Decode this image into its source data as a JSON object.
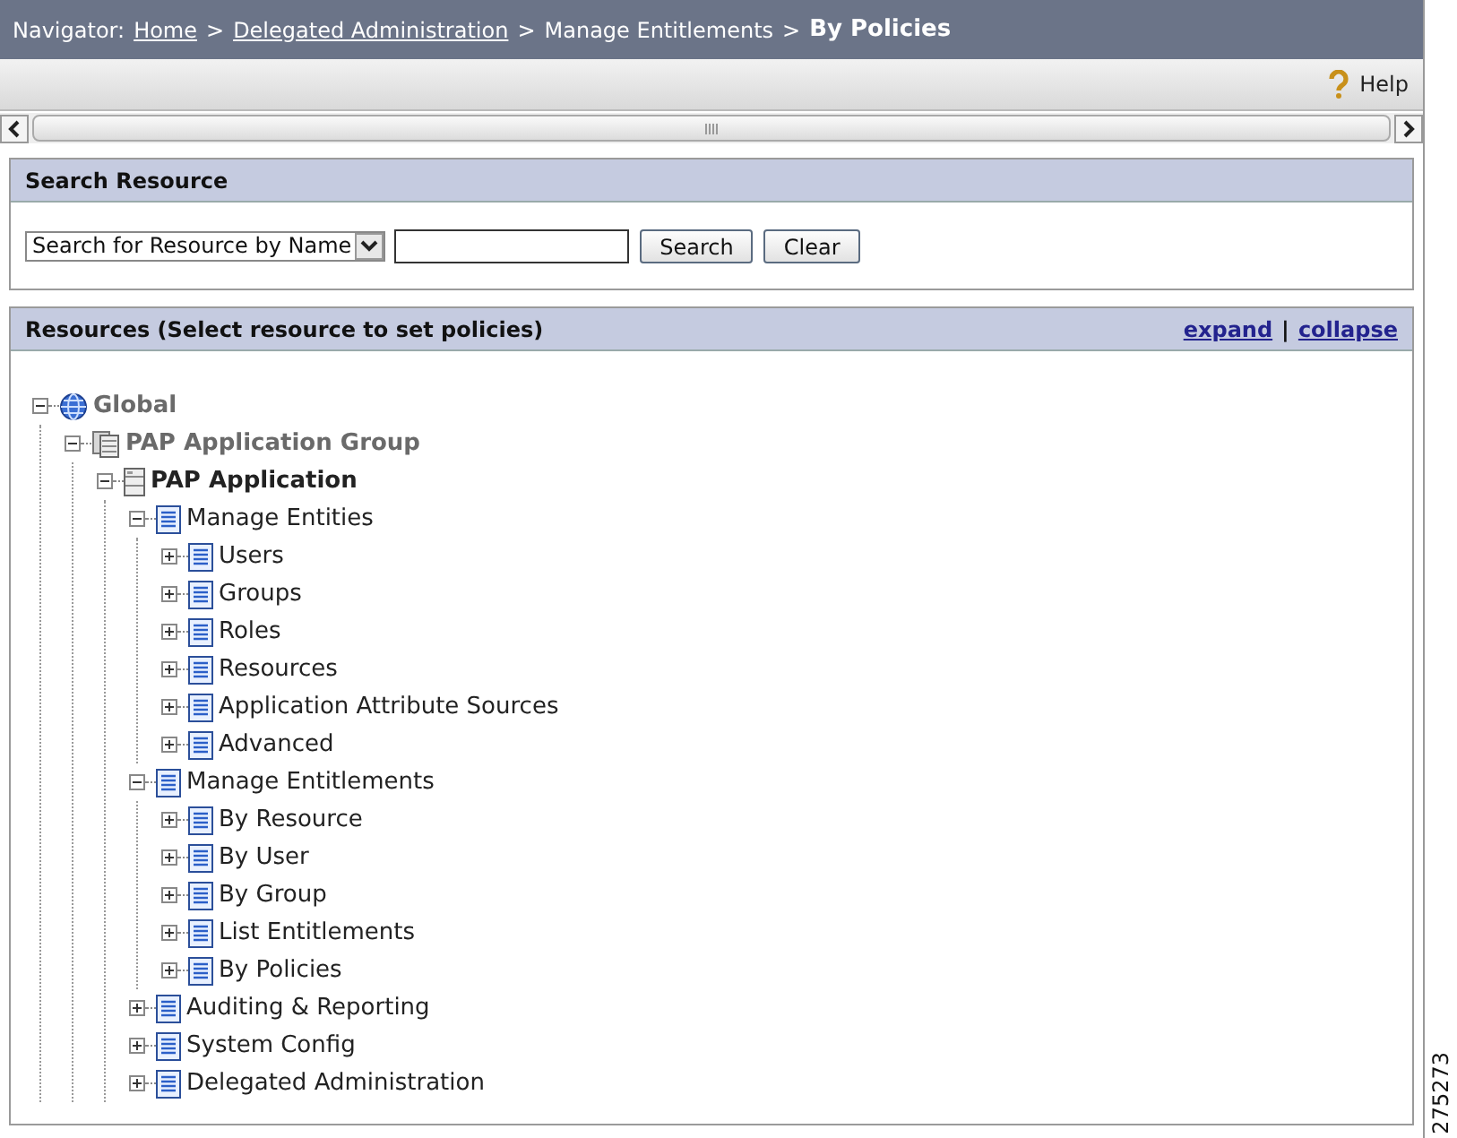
{
  "navigator": {
    "label": "Navigator:",
    "crumbs": [
      {
        "text": "Home",
        "kind": "link"
      },
      {
        "text": "Delegated Administration",
        "kind": "link"
      },
      {
        "text": "Manage Entitlements",
        "kind": "plain"
      },
      {
        "text": "By Policies",
        "kind": "current"
      }
    ],
    "separator": ">"
  },
  "toolbar": {
    "help": "Help"
  },
  "search_panel": {
    "title": "Search Resource",
    "select_value": "Search for Resource by Name",
    "buttons": [
      "Search",
      "Clear"
    ]
  },
  "resources_panel": {
    "title": "Resources (Select resource to set policies)",
    "links": [
      "expand",
      "collapse"
    ],
    "link_separator": "|",
    "tree": [
      {
        "label": "Global",
        "kind": "globe",
        "expanded": true,
        "children": [
          {
            "label": "PAP Application Group",
            "kind": "group",
            "expanded": true,
            "children": [
              {
                "label": "PAP Application",
                "kind": "app",
                "expanded": true,
                "children": [
                  {
                    "label": "Manage Entities",
                    "kind": "page",
                    "expanded": true,
                    "children": [
                      {
                        "label": "Users",
                        "kind": "page",
                        "expanded": false
                      },
                      {
                        "label": "Groups",
                        "kind": "page",
                        "expanded": false
                      },
                      {
                        "label": "Roles",
                        "kind": "page",
                        "expanded": false
                      },
                      {
                        "label": "Resources",
                        "kind": "page",
                        "expanded": false
                      },
                      {
                        "label": "Application Attribute Sources",
                        "kind": "page",
                        "expanded": false
                      },
                      {
                        "label": "Advanced",
                        "kind": "page",
                        "expanded": false
                      }
                    ]
                  },
                  {
                    "label": "Manage Entitlements",
                    "kind": "page",
                    "expanded": true,
                    "children": [
                      {
                        "label": "By Resource",
                        "kind": "page",
                        "expanded": false
                      },
                      {
                        "label": "By User",
                        "kind": "page",
                        "expanded": false
                      },
                      {
                        "label": "By Group",
                        "kind": "page",
                        "expanded": false
                      },
                      {
                        "label": "List Entitlements",
                        "kind": "page",
                        "expanded": false
                      },
                      {
                        "label": "By Policies",
                        "kind": "page",
                        "expanded": false
                      }
                    ]
                  },
                  {
                    "label": "Auditing & Reporting",
                    "kind": "page",
                    "expanded": false
                  },
                  {
                    "label": "System Config",
                    "kind": "page",
                    "expanded": false
                  },
                  {
                    "label": "Delegated Administration",
                    "kind": "page",
                    "expanded": false
                  }
                ]
              }
            ]
          }
        ]
      }
    ]
  },
  "figure_number": "275273"
}
